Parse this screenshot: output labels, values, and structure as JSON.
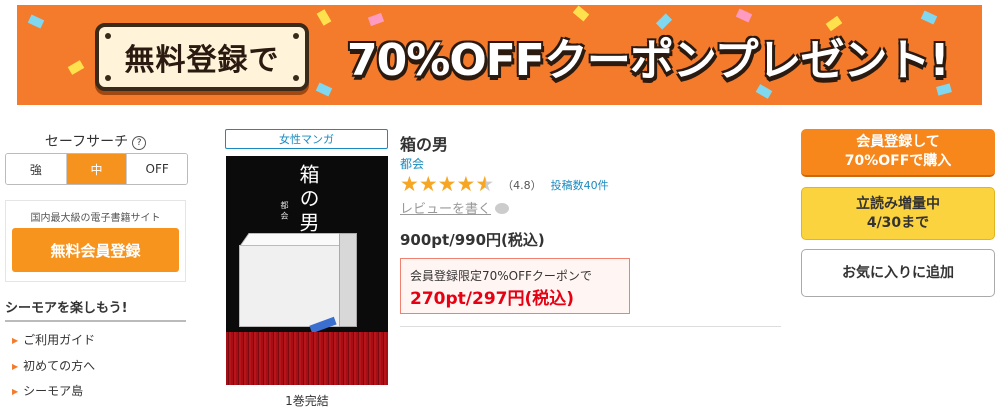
{
  "banner": {
    "plate_text": "無料登録で",
    "main_text": "70%OFFクーポンプレゼント!"
  },
  "safe_search": {
    "title": "セーフサーチ",
    "help_icon": "?",
    "options": [
      "強",
      "中",
      "OFF"
    ],
    "selected": "中"
  },
  "register_box": {
    "caption": "国内最大級の電子書籍サイト",
    "button": "無料会員登録"
  },
  "enjoy": {
    "heading": "シーモアを楽しもう!",
    "links": [
      "ご利用ガイド",
      "初めての方へ",
      "シーモア島"
    ]
  },
  "book": {
    "genre_tag": "女性マンガ",
    "cover_title": "箱の男",
    "cover_author": "都 会",
    "volume_note": "1巻完結",
    "title": "箱の男",
    "author": "都会",
    "rating_value": 4.8,
    "rating_text": "（4.8）",
    "review_count": "投稿数40件",
    "write_review": "レビューを書く",
    "price": "900pt/990円(税込)",
    "coupon_caption": "会員登録限定70%OFFクーポンで",
    "coupon_price": "270pt/297円(税込)"
  },
  "actions": {
    "buy_line1": "会員登録して",
    "buy_line2": "70%OFFで購入",
    "tachiyomi_line1": "立読み増量中",
    "tachiyomi_line2": "4/30まで",
    "favorite": "お気に入りに追加"
  },
  "colors": {
    "accent_orange": "#f7941e",
    "link_blue": "#1a8bc0",
    "price_red": "#e60012",
    "banner_bg": "#f47a2c",
    "tachiyomi_yellow": "#fbd33e"
  }
}
